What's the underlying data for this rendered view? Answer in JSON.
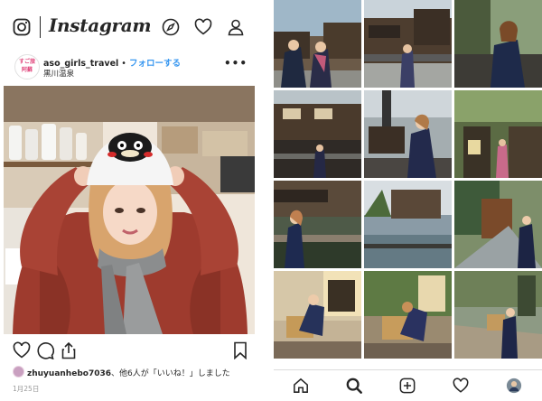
{
  "app": {
    "wordmark": "Instagram"
  },
  "post": {
    "avatar_text_1": "すご旅",
    "avatar_text_2": "阿蘇",
    "username": "aso_girls_travel",
    "separator": " • ",
    "follow_label": "フォローする",
    "location": "黒川温泉",
    "more_label": "•••",
    "likes_user": "zhuyuanhebo7036",
    "likes_rest": "、他6人が「いいね！」しました",
    "date": "1月25日"
  },
  "colors": {
    "link_blue": "#3897f0",
    "text": "#262626",
    "muted": "#999999",
    "divider": "#dbdbdb"
  },
  "icons": {
    "topbar": [
      "instagram-logo-icon",
      "compass-icon",
      "heart-icon",
      "person-icon"
    ],
    "actions": [
      "heart-icon",
      "comment-icon",
      "share-icon",
      "bookmark-icon"
    ],
    "bottom_nav": [
      "home-icon",
      "search-icon",
      "add-post-icon",
      "activity-heart-icon",
      "profile-avatar-icon"
    ]
  },
  "grid": {
    "columns": 3,
    "rows": 4,
    "thumbnails": [
      "two-women-in-yukata-by-inn",
      "woman-on-bridge-by-inn",
      "woman-smiling-on-balcony",
      "inn-buildings-by-river",
      "woman-in-dark-coat-lamp",
      "woman-near-lantern-foliage",
      "bridge-over-river-woman",
      "river-with-wooden-houses",
      "woman-walking-stone-path",
      "wooden-inn-wall-crouching",
      "woman-with-wooden-crate",
      "woman-with-crate-on-deck"
    ]
  }
}
